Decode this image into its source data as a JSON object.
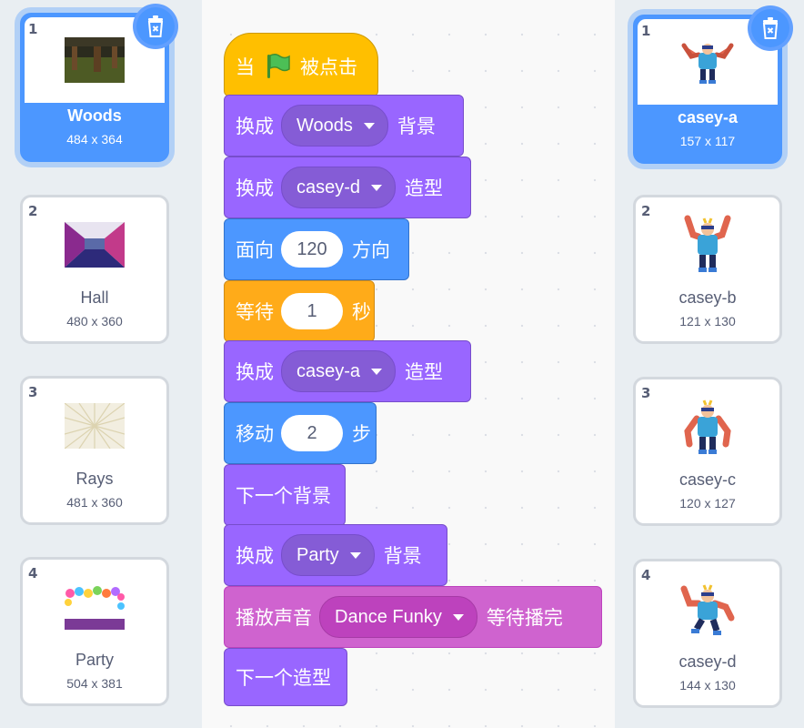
{
  "backdrops": [
    {
      "number": "1",
      "name": "Woods",
      "size": "484 x 364",
      "selected": true
    },
    {
      "number": "2",
      "name": "Hall",
      "size": "480 x 360",
      "selected": false
    },
    {
      "number": "3",
      "name": "Rays",
      "size": "481 x 360",
      "selected": false
    },
    {
      "number": "4",
      "name": "Party",
      "size": "504 x 381",
      "selected": false
    }
  ],
  "costumes": [
    {
      "number": "1",
      "name": "casey-a",
      "size": "157 x 117",
      "selected": true
    },
    {
      "number": "2",
      "name": "casey-b",
      "size": "121 x 130",
      "selected": false
    },
    {
      "number": "3",
      "name": "casey-c",
      "size": "120 x 127",
      "selected": false
    },
    {
      "number": "4",
      "name": "casey-d",
      "size": "144 x 130",
      "selected": false
    }
  ],
  "script": {
    "hat": {
      "prefix": "当",
      "suffix": "被点击"
    },
    "b1": {
      "label": "换成",
      "value": "Woods",
      "suffix": "背景"
    },
    "b2": {
      "label": "换成",
      "value": "casey-d",
      "suffix": "造型"
    },
    "b3": {
      "label": "面向",
      "value": "120",
      "suffix": "方向"
    },
    "b4": {
      "label": "等待",
      "value": "1",
      "suffix": "秒"
    },
    "b5": {
      "label": "换成",
      "value": "casey-a",
      "suffix": "造型"
    },
    "b6": {
      "label": "移动",
      "value": "2",
      "suffix": "步"
    },
    "b7": {
      "label": "下一个背景"
    },
    "b8": {
      "label": "换成",
      "value": "Party",
      "suffix": "背景"
    },
    "b9": {
      "label": "播放声音",
      "value": "Dance Funky",
      "suffix": "等待播完"
    },
    "b10": {
      "label": "下一个造型"
    }
  },
  "colors": {
    "looks": "#9966ff",
    "motion": "#4c97ff",
    "control": "#ffab19",
    "sound": "#cf63cf",
    "events": "#ffbf00",
    "selection": "#4c97ff"
  },
  "icons": {
    "delete": "trash-icon",
    "flag": "green-flag-icon",
    "dropdown": "caret-down-icon"
  }
}
